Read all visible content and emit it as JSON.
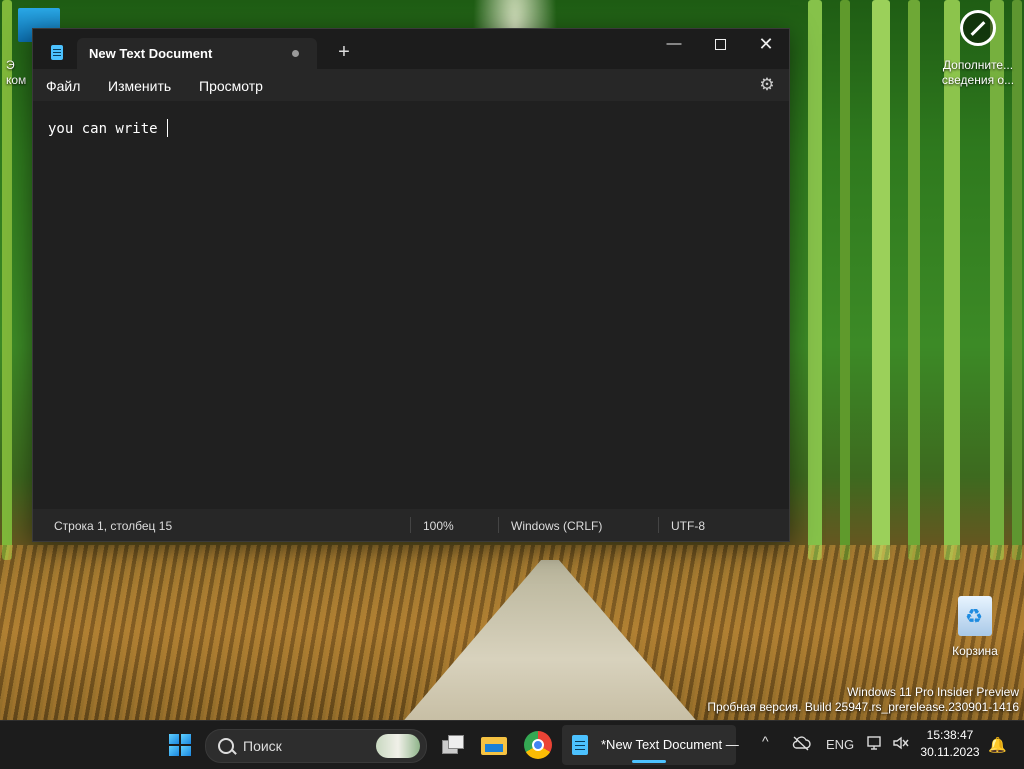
{
  "desktop": {
    "left_icon_label": "Э\nком",
    "info_icon_label": "Дополнительные сведения о...",
    "info_icon_line1": "Дополните...",
    "info_icon_line2": "сведения о...",
    "recycle_bin_label": "Корзина",
    "watermark_line1": "Windows 11 Pro Insider Preview",
    "watermark_line2": "Пробная версия. Build 25947.rs_prerelease.230901-1416"
  },
  "window": {
    "tab_title": "New Text Document",
    "new_tab_glyph": "+",
    "minimize_glyph": "—",
    "close_glyph": "✕",
    "menu": {
      "file": "Файл",
      "edit": "Изменить",
      "view": "Просмотр"
    },
    "settings_glyph": "⚙",
    "editor_text": "you can write ",
    "status": {
      "position": "Строка 1, столбец 15",
      "zoom": "100%",
      "line_endings": "Windows (CRLF)",
      "encoding": "UTF-8"
    }
  },
  "taskbar": {
    "search_placeholder": "Поиск",
    "notepad_task_label": "*New Text Document —",
    "tray_chevron": "^",
    "language": "ENG",
    "time": "15:38:47",
    "date": "30.11.2023",
    "bell_glyph": "🔔"
  },
  "colors": {
    "accent": "#4cc2ff",
    "window_bg": "#202020",
    "taskbar_bg": "#1c1c1c"
  },
  "icons": [
    "notepad-icon",
    "gear-icon",
    "search-icon",
    "start-icon",
    "task-view-icon",
    "file-explorer-icon",
    "chrome-icon",
    "recycle-bin-icon",
    "info-icon",
    "bell-icon"
  ]
}
